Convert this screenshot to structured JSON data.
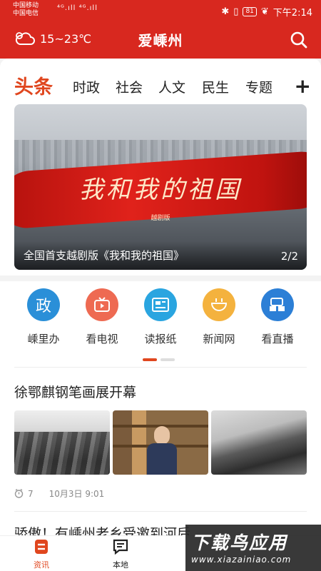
{
  "status_bar": {
    "carrier1": "中国移动",
    "carrier2": "中国电信",
    "signal": "⁴ᴳ.ıll ⁴ᴳ.ıll",
    "battery": "81",
    "time": "下午2:14"
  },
  "header": {
    "weather": "15~23℃",
    "title": "爱嵊州",
    "weather_icon": "cloud-icon",
    "search_icon": "search-icon"
  },
  "tabs": {
    "active": "头条",
    "items": [
      "时政",
      "社会",
      "人文",
      "民生",
      "专题"
    ],
    "more": "+"
  },
  "banner": {
    "art_text": "我和我的祖国",
    "art_sub": "越剧版",
    "caption": "全国首支越剧版《我和我的祖国》",
    "pager": "2/2"
  },
  "quick_links": [
    {
      "label": "嵊里办",
      "glyph": "政",
      "color": "#2a8fd8"
    },
    {
      "label": "看电视",
      "glyph": "📺",
      "color": "#ee6a52"
    },
    {
      "label": "读报纸",
      "glyph": "▤",
      "color": "#2aa5e0"
    },
    {
      "label": "新闻网",
      "glyph": "⌂",
      "color": "#f4b23e"
    },
    {
      "label": "看直播",
      "glyph": "▣",
      "color": "#2c7fd6"
    }
  ],
  "news": {
    "title": "徐鄂麒钢笔画展开幕",
    "views": "7",
    "date": "10月3日 9:01",
    "next_title": "骄傲！有嵊州老乡受邀到河后"
  },
  "bottom_tabs": [
    {
      "label": "资讯",
      "active": true
    },
    {
      "label": "本地",
      "active": false
    }
  ],
  "watermark": {
    "big": "下载鸟应用",
    "small": "www.xiazainiao.com"
  },
  "colors": {
    "brand": "#d8281f",
    "accent": "#e0461e"
  }
}
